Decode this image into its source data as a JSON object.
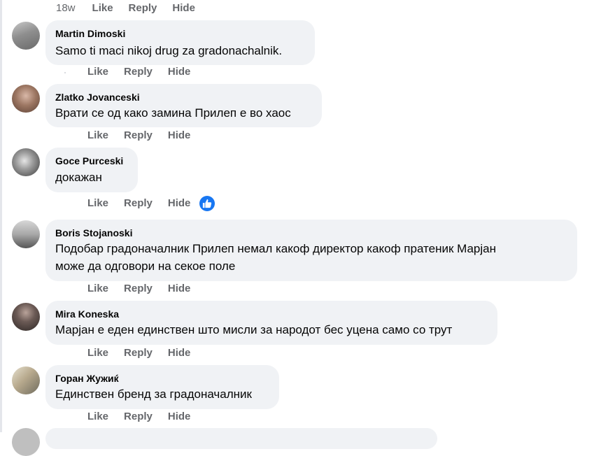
{
  "top_row": {
    "timestamp": "18w",
    "like": "Like",
    "reply": "Reply",
    "hide": "Hide"
  },
  "comments": [
    {
      "author": "Martin Dimoski",
      "lines": [
        "Samo ti maci nikoj drug za gradonachalnik."
      ],
      "actions": {
        "like": "Like",
        "reply": "Reply",
        "hide": "Hide"
      },
      "reaction": ""
    },
    {
      "author": "Zlatko Jovanceski",
      "lines": [
        "Врати се од како замина Прилеп е во хаос"
      ],
      "actions": {
        "like": "Like",
        "reply": "Reply",
        "hide": "Hide"
      },
      "reaction": ""
    },
    {
      "author": "Goce Purceski",
      "lines": [
        "докажан"
      ],
      "actions": {
        "like": "Like",
        "reply": "Reply",
        "hide": "Hide"
      },
      "reaction": "like-icon"
    },
    {
      "author": "Boris Stojanoski",
      "lines": [
        "Подобар градоначалник Прилеп немал какоф директор какоф пратеник Марјан",
        "може да одговори на секое поле"
      ],
      "actions": {
        "like": "Like",
        "reply": "Reply",
        "hide": "Hide"
      },
      "reaction": ""
    },
    {
      "author": "Mira Koneska",
      "lines": [
        "Марјан е еден единствен што мисли за народот бес уцена само со трут"
      ],
      "actions": {
        "like": "Like",
        "reply": "Reply",
        "hide": "Hide"
      },
      "reaction": ""
    },
    {
      "author": "Горан Жужиќ",
      "lines": [
        "Единствен бренд за градоначалник"
      ],
      "actions": {
        "like": "Like",
        "reply": "Reply",
        "hide": "Hide"
      },
      "reaction": ""
    }
  ],
  "colors": {
    "bubble": "#f0f2f5",
    "meta": "#65676b",
    "text": "#050505",
    "like_reaction": "#1877f2"
  }
}
